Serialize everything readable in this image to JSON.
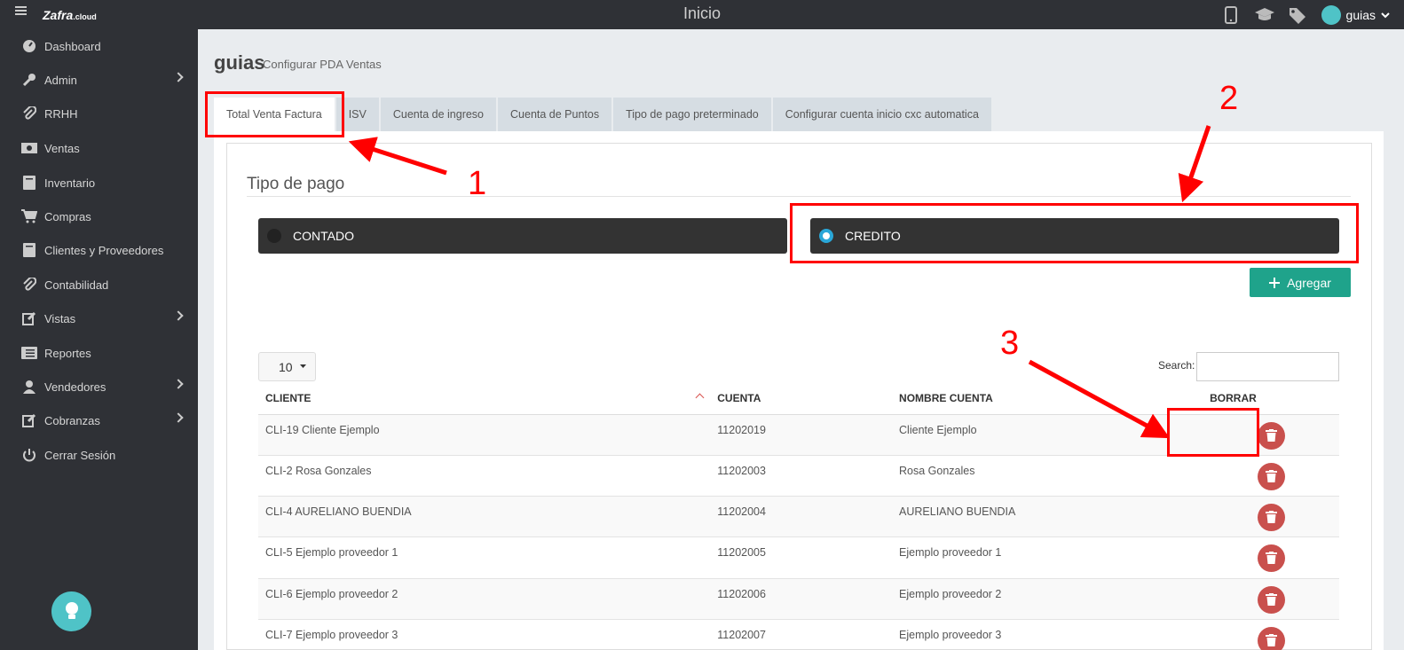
{
  "topbar": {
    "title": "Inicio",
    "logo_main": "Zafra",
    "logo_suffix": ".cloud",
    "user_name": "guias"
  },
  "sidebar": {
    "items": [
      {
        "label": "Dashboard",
        "icon": "dashboard-icon"
      },
      {
        "label": "Admin",
        "icon": "wrench-icon"
      },
      {
        "label": "RRHH",
        "icon": "paperclip-icon"
      },
      {
        "label": "Ventas",
        "icon": "money-icon"
      },
      {
        "label": "Inventario",
        "icon": "book-icon"
      },
      {
        "label": "Compras",
        "icon": "cart-icon"
      },
      {
        "label": "Clientes y Proveedores",
        "icon": "book-icon"
      },
      {
        "label": "Contabilidad",
        "icon": "paperclip-icon"
      },
      {
        "label": "Vistas",
        "icon": "edit-icon"
      },
      {
        "label": "Reportes",
        "icon": "list-icon"
      },
      {
        "label": "Vendedores",
        "icon": "user-icon"
      },
      {
        "label": "Cobranzas",
        "icon": "edit-icon"
      },
      {
        "label": "Cerrar Sesión",
        "icon": "power-icon"
      }
    ]
  },
  "page": {
    "title": "guias",
    "subtitle": "Configurar PDA Ventas"
  },
  "tabs": [
    "Total Venta Factura",
    "ISV",
    "Cuenta de ingreso",
    "Cuenta de Puntos",
    "Tipo de pago preterminado",
    "Configurar cuenta inicio cxc automatica"
  ],
  "section": {
    "title": "Tipo de pago",
    "option_contado": "CONTADO",
    "option_credito": "CREDITO",
    "add_label": "Agregar"
  },
  "table_controls": {
    "page_length": "10",
    "search_label": "Search:"
  },
  "table": {
    "headers": [
      "CLIENTE",
      "CUENTA",
      "NOMBRE CUENTA",
      "BORRAR"
    ],
    "rows": [
      {
        "cliente": "CLI-19 Cliente Ejemplo",
        "cuenta": "11202019",
        "nombre": "Cliente Ejemplo"
      },
      {
        "cliente": "CLI-2 Rosa Gonzales",
        "cuenta": "11202003",
        "nombre": "Rosa Gonzales"
      },
      {
        "cliente": "CLI-4 AURELIANO BUENDIA",
        "cuenta": "11202004",
        "nombre": "AURELIANO BUENDIA"
      },
      {
        "cliente": "CLI-5 Ejemplo proveedor 1",
        "cuenta": "11202005",
        "nombre": "Ejemplo proveedor 1"
      },
      {
        "cliente": "CLI-6 Ejemplo proveedor 2",
        "cuenta": "11202006",
        "nombre": "Ejemplo proveedor 2"
      },
      {
        "cliente": "CLI-7 Ejemplo proveedor 3",
        "cuenta": "11202007",
        "nombre": "Ejemplo proveedor 3"
      }
    ]
  },
  "annotations": {
    "n1": "1",
    "n2": "2",
    "n3": "3",
    "color": "#ff0000"
  }
}
